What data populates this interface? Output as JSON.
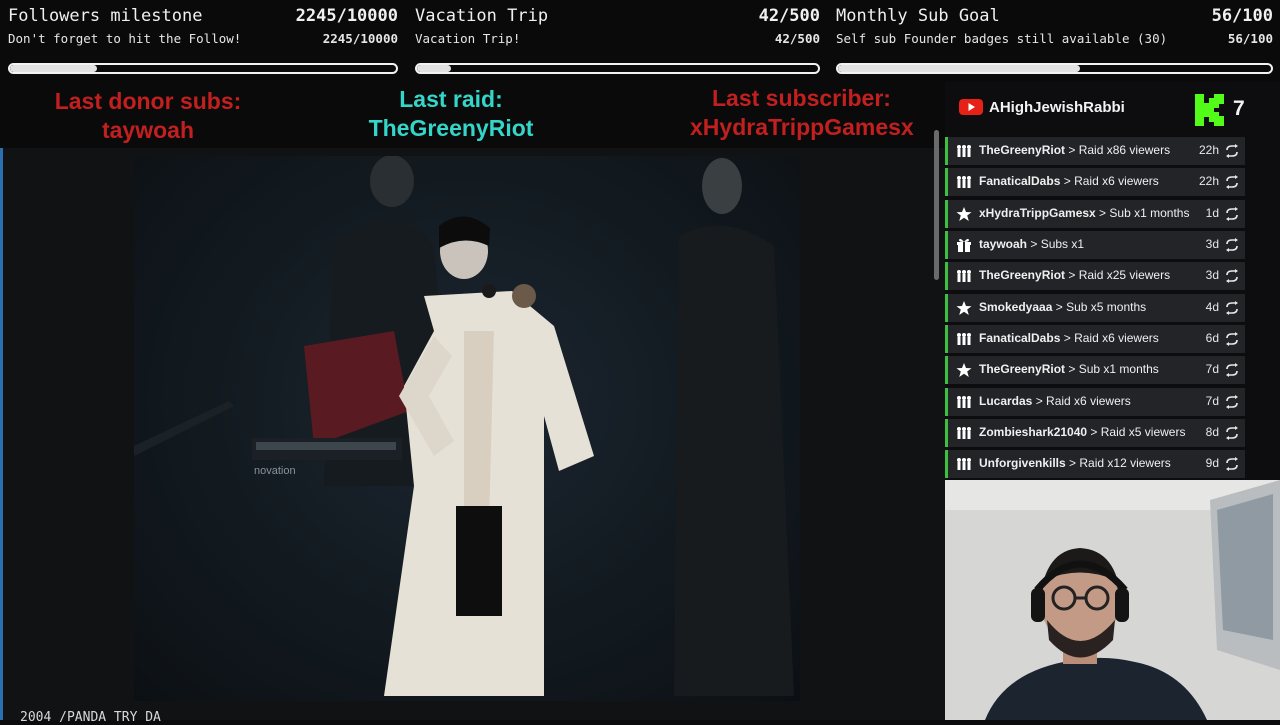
{
  "goals": [
    {
      "name": "Followers milestone",
      "count": "2245/10000",
      "subtitle": "Don't forget to hit the Follow!",
      "count2": "2245/10000",
      "progress": 0.2245
    },
    {
      "name": "Vacation Trip",
      "count": "42/500",
      "subtitle": "Vacation Trip!",
      "count2": "42/500",
      "progress": 0.084
    },
    {
      "name": "Monthly Sub Goal",
      "count": "56/100",
      "subtitle": "Self sub Founder badges still available (30)",
      "count2": "56/100",
      "progress": 0.56
    }
  ],
  "last": {
    "donor": {
      "label": "Last donor subs:",
      "value": "taywoah",
      "color": "#c21f1f"
    },
    "raid": {
      "label": "Last raid:",
      "value": "TheGreenyRiot",
      "color": "#33d6c8"
    },
    "subscriber": {
      "label": "Last subscriber:",
      "value": "xHydraTrippGamesx",
      "color": "#c21f1f"
    }
  },
  "panel": {
    "youtube_handle": "AHighJewishRabbi",
    "kick_count": "7",
    "events": [
      {
        "user": "TheGreenyRiot",
        "action": "Raid x86 viewers",
        "time": "22h",
        "icon": "raid-icon"
      },
      {
        "user": "FanaticalDabs",
        "action": "Raid x6 viewers",
        "time": "22h",
        "icon": "raid-icon"
      },
      {
        "user": "xHydraTrippGamesx",
        "action": "Sub x1 months",
        "time": "1d",
        "icon": "star-icon"
      },
      {
        "user": "taywoah",
        "action": "Subs x1",
        "time": "3d",
        "icon": "gift-icon"
      },
      {
        "user": "TheGreenyRiot",
        "action": "Raid x25 viewers",
        "time": "3d",
        "icon": "raid-icon"
      },
      {
        "user": "Smokedyaaa",
        "action": "Sub x5 months",
        "time": "4d",
        "icon": "star-icon"
      },
      {
        "user": "FanaticalDabs",
        "action": "Raid x6 viewers",
        "time": "6d",
        "icon": "raid-icon"
      },
      {
        "user": "TheGreenyRiot",
        "action": "Sub x1 months",
        "time": "7d",
        "icon": "star-icon"
      },
      {
        "user": "Lucardas",
        "action": "Raid x6 viewers",
        "time": "7d",
        "icon": "raid-icon"
      },
      {
        "user": "Zombieshark21040",
        "action": "Raid x5 viewers",
        "time": "8d",
        "icon": "raid-icon"
      },
      {
        "user": "Unforgivenkills",
        "action": "Raid x12 viewers",
        "time": "9d",
        "icon": "raid-icon"
      }
    ]
  },
  "video": {
    "caption": "2004 /PANDA TRY DA"
  },
  "colors": {
    "event_accent": "#3fbf3f",
    "youtube": "#e62117",
    "kick": "#53fc18"
  }
}
